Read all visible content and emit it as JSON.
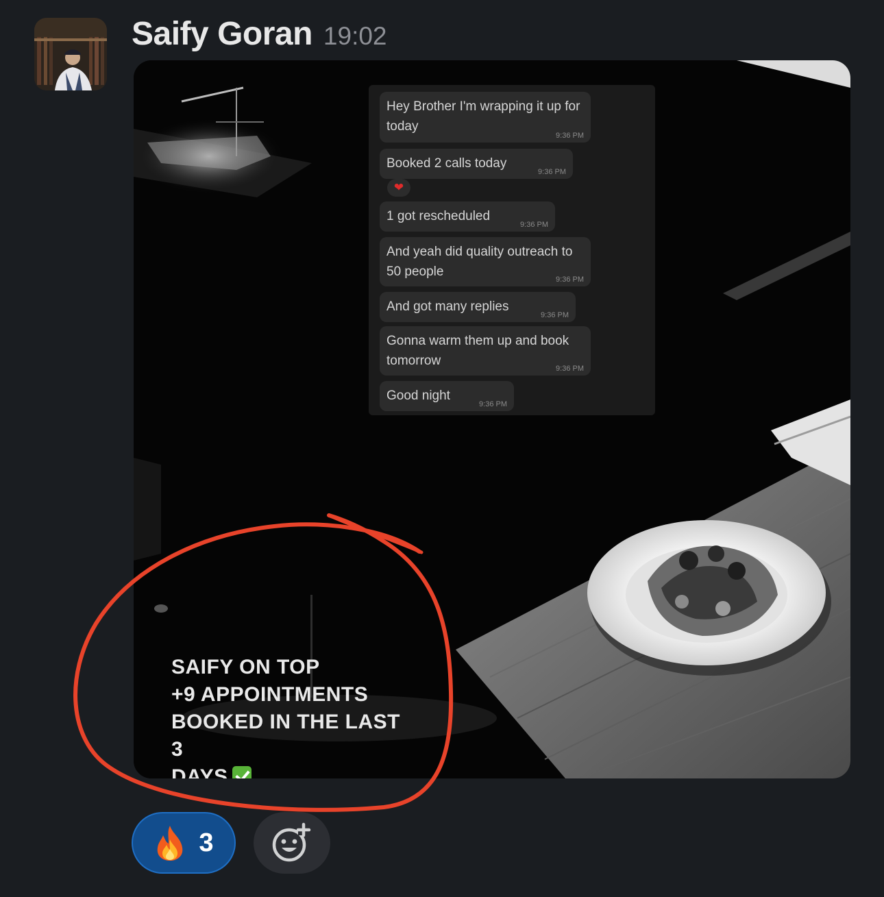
{
  "message": {
    "sender_name": "Saify Goran",
    "timestamp": "19:02"
  },
  "attachment": {
    "chat_messages": [
      {
        "text": "Hey Brother I'm wrapping it up for today",
        "time": "9:36 PM"
      },
      {
        "text": "Booked 2 calls today",
        "time": "9:36 PM"
      },
      {
        "text": "1 got rescheduled",
        "time": "9:36 PM"
      },
      {
        "text": "And yeah did quality outreach to 50 people",
        "time": "9:36 PM"
      },
      {
        "text": "And got many replies",
        "time": "9:36 PM"
      },
      {
        "text": "Gonna warm them up and book tomorrow",
        "time": "9:36 PM"
      },
      {
        "text": "Good night",
        "time": "9:36 PM"
      }
    ],
    "heart_reaction": "❤",
    "overlay_caption": "SAIFY ON TOP\n+9 APPOINTMENTS\nBOOKED IN THE LAST 3\nDAYS",
    "annotation_color": "#e8432a"
  },
  "reactions": [
    {
      "emoji": "fire-icon",
      "count": "3"
    }
  ],
  "add_reaction_icon": "smiley-plus-icon",
  "colors": {
    "background": "#1a1d21",
    "reaction_active_bg": "#124d8d",
    "reaction_active_border": "#1f6fc5"
  }
}
